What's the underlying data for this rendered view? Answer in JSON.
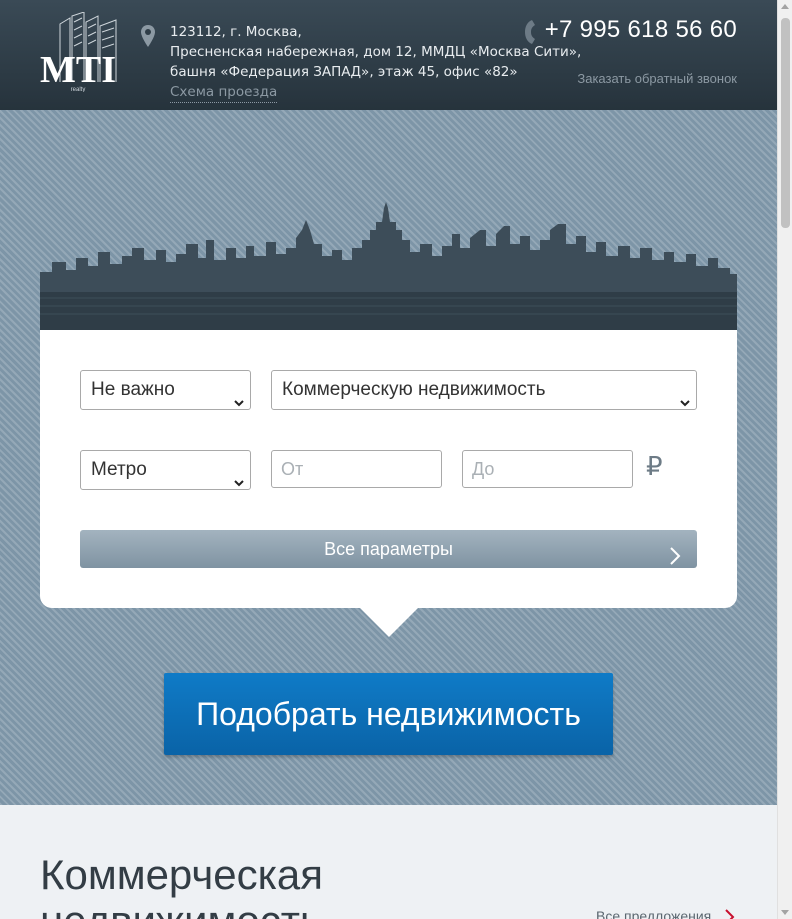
{
  "header": {
    "logo_text": "MTI",
    "logo_subtext": "realty",
    "address_lines": [
      "123112, г. Москва,",
      "Пресненская набережная, дом 12, ММДЦ «Москва Сити»,",
      "башня «Федерация ЗАПАД», этаж 45, офис «82»"
    ],
    "map_link": "Схема проезда",
    "phone": "+7 995 618 56 60",
    "callback_link": "Заказать обратный звонок"
  },
  "search": {
    "deal_select": "Не важно",
    "type_select": "Коммерческую недвижимость",
    "metro_select": "Метро",
    "price_from_placeholder": "От",
    "price_to_placeholder": "До",
    "currency_symbol": "₽",
    "all_params_label": "Все параметры",
    "submit_label": "Подобрать недвижимость"
  },
  "section": {
    "title_line1": "Коммерческая",
    "title_line2": "недвижимость",
    "all_offers_link": "Все предложения"
  },
  "colors": {
    "header_bg": "#2c3a44",
    "hero_bg": "#7d95a7",
    "accent_blue": "#0f7bc7",
    "params_bar": "#8fa1ae"
  },
  "icons": {
    "location": "map-pin-icon",
    "phone": "phone-icon",
    "chevron": "chevron-right-icon",
    "dropdown": "chevron-down-icon"
  }
}
